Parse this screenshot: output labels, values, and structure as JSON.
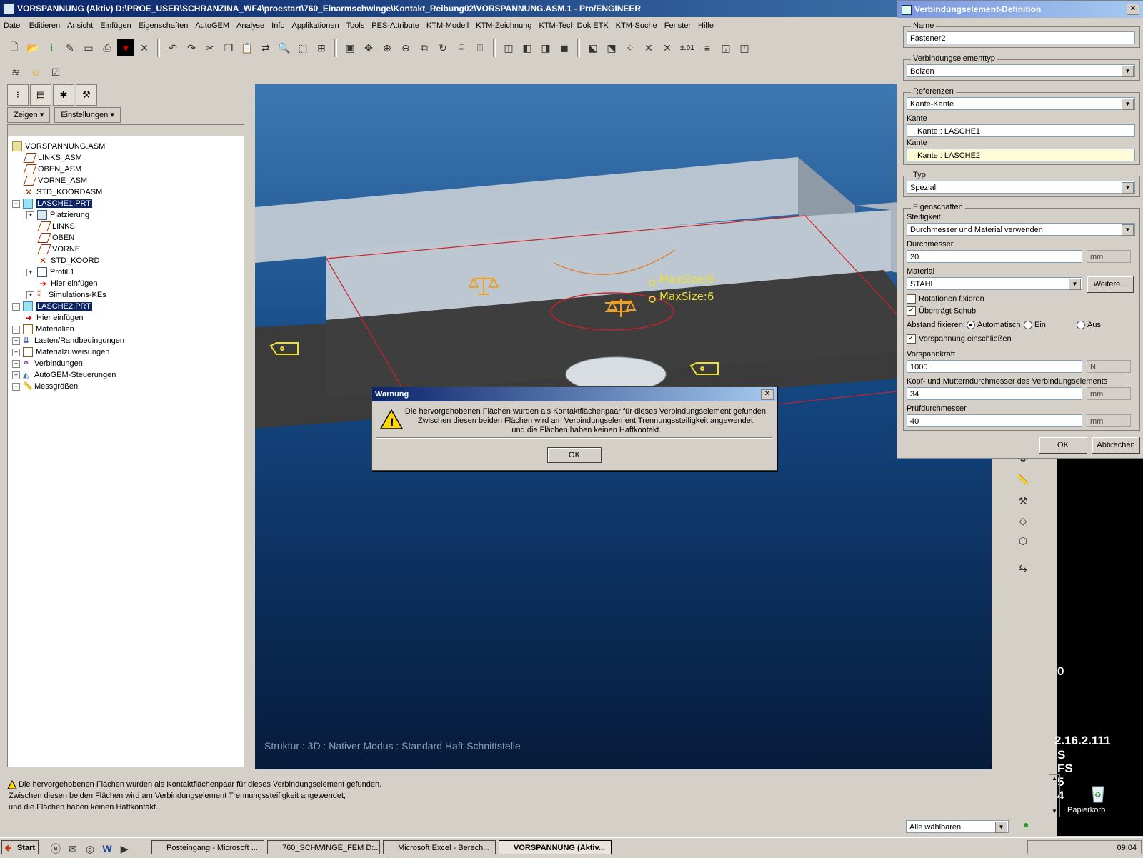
{
  "window": {
    "title": "VORSPANNUNG (Aktiv) D:\\PROE_USER\\SCHRANZINA_WF4\\proestart\\760_Einarmschwinge\\Kontakt_Reibung02\\VORSPANNUNG.ASM.1 - Pro/ENGINEER"
  },
  "menu": [
    "Datei",
    "Editieren",
    "Ansicht",
    "Einfügen",
    "Eigenschaften",
    "AutoGEM",
    "Analyse",
    "Info",
    "Applikationen",
    "Tools",
    "PES-Attribute",
    "KTM-Modell",
    "KTM-Zeichnung",
    "KTM-Tech Dok ETK",
    "KTM-Suche",
    "Fenster",
    "Hilfe"
  ],
  "toolbar": {
    "precision_label": "±.01"
  },
  "left_panel": {
    "show_button": "Zeigen",
    "settings_button": "Einstellungen",
    "tree": [
      {
        "label": "VORSPANNUNG.ASM"
      },
      {
        "label": "LINKS_ASM"
      },
      {
        "label": "OBEN_ASM"
      },
      {
        "label": "VORNE_ASM"
      },
      {
        "label": "STD_KOORDASM"
      },
      {
        "label": "LASCHE1.PRT"
      },
      {
        "label": "Platzierung"
      },
      {
        "label": "LINKS"
      },
      {
        "label": "OBEN"
      },
      {
        "label": "VORNE"
      },
      {
        "label": "STD_KOORD"
      },
      {
        "label": "Profil 1"
      },
      {
        "label": "Hier einfügen"
      },
      {
        "label": "Simulations-KEs"
      },
      {
        "label": "LASCHE2.PRT"
      },
      {
        "label": "Hier einfügen"
      },
      {
        "label": "Materialien"
      },
      {
        "label": "Lasten/Randbedingungen"
      },
      {
        "label": "Materialzuweisungen"
      },
      {
        "label": "Verbindungen"
      },
      {
        "label": "AutoGEM-Steuerungen"
      },
      {
        "label": "Messgrößen"
      }
    ]
  },
  "viewport": {
    "labels": [
      "MaxSize:6",
      "MaxSize:6"
    ],
    "status": "Struktur : 3D : Nativer Modus : Standard Haft-Schnittstelle"
  },
  "fastener_dialog": {
    "title": "Verbindungselement-Definition",
    "name_label": "Name",
    "name_value": "Fastener2",
    "type_group": "Verbindungselementtyp",
    "type_value": "Bolzen",
    "refs_group": "Referenzen",
    "refs_value": "Kante-Kante",
    "edge1_label": "Kante",
    "edge1_value": "Kante : LASCHE1",
    "edge2_label": "Kante",
    "edge2_value": "Kante : LASCHE2",
    "typ_group": "Typ",
    "typ_value": "Spezial",
    "props_group": "Eigenschaften",
    "stiffness_label": "Steifigkeit",
    "stiffness_value": "Durchmesser und Material verwenden",
    "diameter_label": "Durchmesser",
    "diameter_value": "20",
    "diameter_unit": "mm",
    "material_label": "Material",
    "material_value": "STAHL",
    "more_button": "Weitere...",
    "fix_rotations": "Rotationen fixieren",
    "transfers_shear": "Überträgt Schub",
    "fix_distance_label": "Abstand fixieren:",
    "radio_auto": "Automatisch",
    "radio_on": "Ein",
    "radio_off": "Aus",
    "include_preload": "Vorspannung einschließen",
    "preload_label": "Vorspannkraft",
    "preload_value": "1000",
    "preload_unit": "N",
    "head_label": "Kopf- und Mutterndurchmesser des Verbindungselements",
    "head_value": "34",
    "head_unit": "mm",
    "test_label": "Prüfdurchmesser",
    "test_value": "40",
    "test_unit": "mm",
    "ok_button": "OK",
    "cancel_button": "Abbrechen"
  },
  "warning": {
    "title": "Warnung",
    "line1": "Die hervorgehobenen Flächen wurden als Kontaktflächenpaar für dieses Verbindungselement gefunden.",
    "line2": "Zwischen diesen beiden Flächen wird am Verbindungselement Trennungssteifigkeit angewendet,",
    "line3": "und die Flächen haben keinen Haftkontakt.",
    "ok": "OK"
  },
  "message_area": {
    "line1": "Die hervorgehobenen Flächen wurden als Kontaktflächenpaar für dieses Verbindungselement gefunden.",
    "line2": "Zwischen diesen beiden Flächen wird am Verbindungselement Trennungssteifigkeit angewendet,",
    "line3": "und die Flächen haben keinen Haftkontakt."
  },
  "filter": {
    "value": "Alle wählbaren"
  },
  "desktop": {
    "recycle_bin": "Papierkorb",
    "fragments": [
      "0",
      "2.16.2.111",
      "S",
      "FS",
      "5",
      "4"
    ]
  },
  "taskbar": {
    "start": "Start",
    "tasks": [
      "Posteingang - Microsoft ...",
      "760_SCHWINGE_FEM D:...",
      "Microsoft Excel - Berech...",
      "VORSPANNUNG (Aktiv..."
    ],
    "clock": "09:04"
  },
  "colors": {
    "accent": "#0a246a",
    "warning": "#ffd800",
    "highlight_red": "#d0202a",
    "symbol_orange": "#f0a020",
    "symbol_yellow": "#f0e030"
  }
}
